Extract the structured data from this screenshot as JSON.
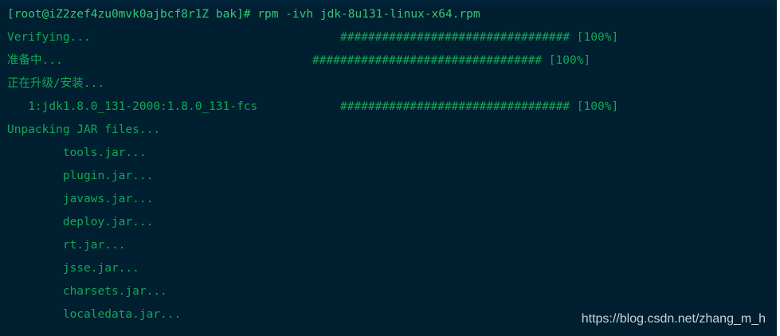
{
  "terminal": {
    "prompt_line": "[root@iZ2zef4zu0mvk0ajbcf8r1Z bak]# rpm -ivh jdk-8u131-linux-x64.rpm",
    "lines": [
      {
        "text": "Verifying...",
        "bar": "################################# [100%]"
      },
      {
        "text": "准备中...",
        "bar": "################################# [100%]"
      },
      {
        "text": "正在升级/安装..."
      },
      {
        "text": "   1:jdk1.8.0_131-2000:1.8.0_131-fcs",
        "bar": "################################# [100%]"
      },
      {
        "text": "Unpacking JAR files..."
      },
      {
        "text": "        tools.jar..."
      },
      {
        "text": "        plugin.jar..."
      },
      {
        "text": "        javaws.jar..."
      },
      {
        "text": "        deploy.jar..."
      },
      {
        "text": "        rt.jar..."
      },
      {
        "text": "        jsse.jar..."
      },
      {
        "text": "        charsets.jar..."
      },
      {
        "text": "        localedata.jar..."
      }
    ]
  },
  "watermark": "https://blog.csdn.net/zhang_m_h",
  "colors": {
    "background": "#001f30",
    "text": "#0fa958"
  }
}
